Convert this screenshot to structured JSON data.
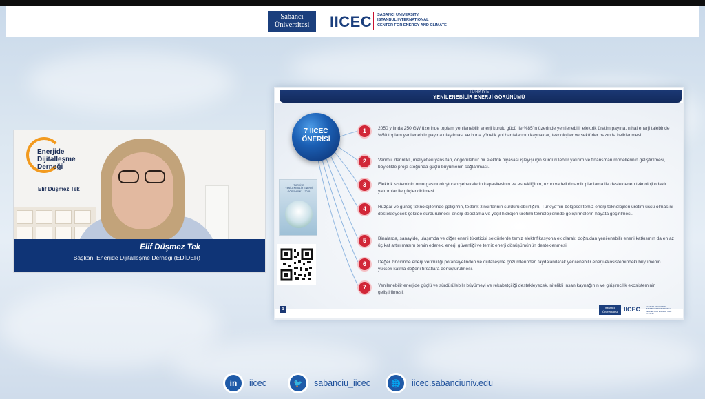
{
  "header": {
    "sabanci_logo": "Sabancı\nÜniversitesi",
    "iicec_logo": "IICEC",
    "iicec_sub": [
      "SABANCI UNIVERSITY",
      "ISTANBUL INTERNATIONAL",
      "CENTER FOR ENERGY AND CLIMATE"
    ]
  },
  "speaker": {
    "org_name": "Enerjide\nDijitalleşme\nDerneği",
    "cam_label": "Elif Düşmez Tek",
    "name": "Elif Düşmez Tek",
    "title": "Başkan, Enerjide Dijitalleşme Derneği (EDİDER)"
  },
  "slide": {
    "supertitle": "TÜRKİYE",
    "title": "YENİLENEBİLİR ENERJİ GÖRÜNÜMÜ",
    "orb_text": "7 IICEC\nÖNERİSİ",
    "page": "1",
    "report_title": "TÜRKİYE\nYENİLENEBİLİR ENERJİ\nGÖRÜNÜMÜ – 2025",
    "recommendations": [
      {
        "num": "1",
        "text": "2050 yılında 250 GW üzerinde toplam yenilenebilir enerji kurulu gücü ile %85'in üzerinde yenilenebilir elektrik üretim payına, nihai enerji talebinde %50 toplam yenilenebilir payına ulaşılması ve buna yönelik yol haritalarının kaynaklar, teknolojiler ve sektörler bazında belirlenmesi."
      },
      {
        "num": "2",
        "text": "Verimli, derinlikli, maliyetleri yansıtan, öngörülebilir bir elektrik piyasası işleyişi için sürdürülebilir yatırım ve finansman modellerinin geliştirilmesi, böylelikle proje stoğunda güçlü büyümenin sağlanması."
      },
      {
        "num": "3",
        "text": "Elektrik sisteminin omurgasını oluşturan şebekelerin kapasitesinin ve esnekliğinin, uzun vadeli dinamik planlama ile desteklenen teknoloji odaklı yatırımlar ile güçlendirilmesi."
      },
      {
        "num": "4",
        "text": "Rüzgar ve güneş teknolojilerinde gelişimin, tedarik zincirlerinin sürdürülebilirliğini, Türkiye'nin bölgesel temiz enerji teknolojileri üretim üssü olmasını destekleyecek şekilde sürdürülmesi; enerji depolama ve yeşil hidrojen üretimi teknolojilerinde geliştirmelerin hayata geçirilmesi."
      },
      {
        "num": "5",
        "text": "Binalarda, sanayide, ulaşımda ve diğer enerji tüketicisi sektörlerde temiz elektrifikasyona ek olarak, doğrudan yenilenebilir enerji katkısının da en az üç kat artırılmasını temin ederek, enerji güvenliği ve temiz enerji dönüşümünün desteklenmesi."
      },
      {
        "num": "6",
        "text": "Değer zincirinde enerji verimliliği potansiyelinden ve dijitalleşme çözümlerinden faydalanılarak yenilenebilir enerji ekosistemindeki büyümenin yüksek katma değerli fırsatlara dönüştürülmesi."
      },
      {
        "num": "7",
        "text": "Yenilenebilir enerjide güçlü ve sürdürülebilir büyümeyi ve rekabetçiliği destekleyecek, nitelikli insan kaynağının ve girişimcilik ekosisteminin geliştirilmesi."
      }
    ],
    "footer_sab": "Sabancı\nÜniversitesi",
    "footer_iicec": "IICEC"
  },
  "social": [
    {
      "icon": "linkedin-icon",
      "glyph": "in",
      "label": "iicec"
    },
    {
      "icon": "twitter-icon",
      "glyph": "🐦",
      "label": "sabanciu_iicec"
    },
    {
      "icon": "globe-icon",
      "glyph": "🌐",
      "label": "iicec.sabanciuniv.edu"
    }
  ],
  "colors": {
    "navy": "#0f3476",
    "accent_red": "#d12738",
    "brand_orange": "#f29a1f"
  }
}
